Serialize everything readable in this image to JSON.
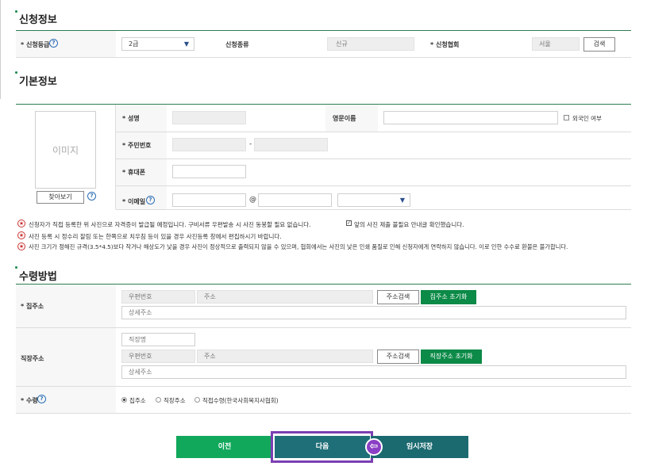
{
  "application_info": {
    "title": "신청정보",
    "grade_label": "* 신청등급",
    "grade_value": "2급",
    "type_label": "신청종류",
    "type_value": "신규",
    "association_label": "* 신청협회",
    "association_value": "서울",
    "search_button": "검색"
  },
  "basic_info": {
    "title": "기본정보",
    "photo_placeholder": "이미지",
    "browse_button": "찾아보기",
    "name_label": "* 성명",
    "english_name_label": "영문이름",
    "foreigner_label": "외국인 여부",
    "resident_no_label": "* 주민번호",
    "resident_no_dash": "-",
    "phone_label": "* 휴대폰",
    "email_label": "* 이메일",
    "email_at": "@",
    "notices": [
      "신청자가 직접 등록한 위 사진으로 자격증이 발급될 예정입니다. 구비서류 우편발송 시 사진 동봉할 필요 없습니다.",
      "사진 등록 시 정수리 잘림 또는 한쪽으로 치우침 등이 있을 경우 사진등록 창에서 편집하시기 바랍니다.",
      "사진 크기가 정해진 규격(3.5*4.5)보다 작거나 해상도가 낮을 경우 사진이 정상적으로 출력되지 않을 수 있으며, 협회에서는 사진의 낮은 인쇄 품질로 인해 신청자에게 연락하지 않습니다. 이로 인한 수수료 환불은 불가합니다."
    ],
    "photo_confirm_label": "앞의 사진 제출 불필요 안내글 확인했습니다."
  },
  "receipt": {
    "title": "수령방법",
    "home_address_label": "* 집주소",
    "postcode_placeholder": "우편번호",
    "address_placeholder": "주소",
    "detail_placeholder": "상세주소",
    "address_search_button": "주소검색",
    "home_reset_button": "집주소 초기화",
    "work_address_label": "직장주소",
    "workplace_placeholder": "직장명",
    "work_reset_button": "직장주소 초기화",
    "receipt_label": "* 수령",
    "options": [
      "집주소",
      "직장주소",
      "직접수령(한국사회복지사협회)"
    ],
    "selected_option": "집주소"
  },
  "actions": {
    "prev_button": "이전",
    "next_button": "다음",
    "save_button": "임시저장"
  },
  "colors": {
    "accent": "#0c8a47",
    "highlight_border": "#7b3fb3",
    "next_button": "#1f6f78"
  }
}
